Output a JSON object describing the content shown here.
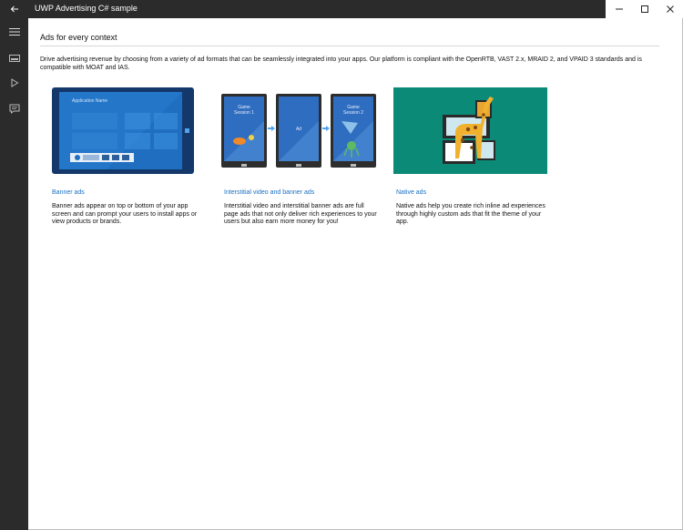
{
  "window": {
    "title": "UWP Advertising C# sample"
  },
  "page": {
    "title": "Ads for every context",
    "intro": "Drive advertising revenue by choosing from a variety of ad formats that can be seamlessly integrated into your apps. Our platform is compliant with the OpenRTB, VAST 2.x, MRAID 2, and VPAID 3 standards and is compatible with MOAT and IAS."
  },
  "cards": [
    {
      "link": "Banner ads",
      "description": "Banner ads appear on top or bottom of your app screen and can prompt your users to install apps or view products or brands.",
      "image_text": "Application Name"
    },
    {
      "link": "Interstitial video and banner ads",
      "description": "Interstitial video and interstitial banner ads are full page ads that not only deliver rich experiences to your users but also earn more money for you!",
      "screens": [
        "Game Session 1",
        "Ad",
        "Game Session 2"
      ]
    },
    {
      "link": "Native ads",
      "description": "Native ads help you create rich inline ad experiences through highly custom ads that fit the theme of your app."
    }
  ],
  "colors": {
    "chrome": "#2b2b2b",
    "link": "#1a6fc2",
    "banner_bg": "#1f6ec0",
    "native_bg": "#0a8a77"
  }
}
